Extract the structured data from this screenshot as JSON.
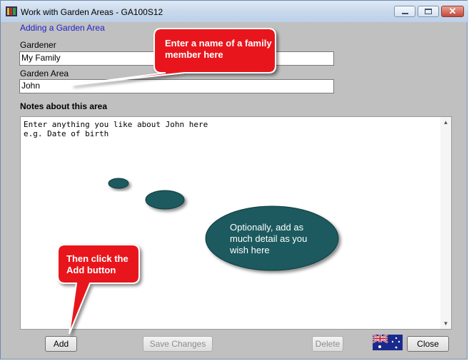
{
  "window": {
    "title": "Work with Garden Areas - GA100S12"
  },
  "form": {
    "subtitle": "Adding a Garden Area",
    "gardener_label": "Gardener",
    "gardener_value": "My Family",
    "area_label": "Garden Area",
    "area_value": "John",
    "notes_heading": "Notes about this area",
    "notes_text": "Enter anything you like about John here\ne.g. Date of birth"
  },
  "buttons": {
    "add": "Add",
    "save_changes": "Save Changes",
    "delete": "Delete",
    "close": "Close"
  },
  "callouts": {
    "name_hint": "Enter a name of a family member here",
    "detail_hint": "Optionally, add as much detail as you wish here",
    "add_hint": "Then click the Add button"
  },
  "icons": {
    "app": "app-icon",
    "minimize": "minimize-icon",
    "maximize": "maximize-icon",
    "close": "close-icon",
    "flag": "australian-flag-icon",
    "scroll_up": "scroll-up-icon",
    "scroll_down": "scroll-down-icon"
  },
  "colors": {
    "window_bg": "#c0c0c0",
    "subtitle": "#1f1fcc",
    "callout_red": "#e8141c",
    "callout_teal": "#1c5a5f"
  }
}
